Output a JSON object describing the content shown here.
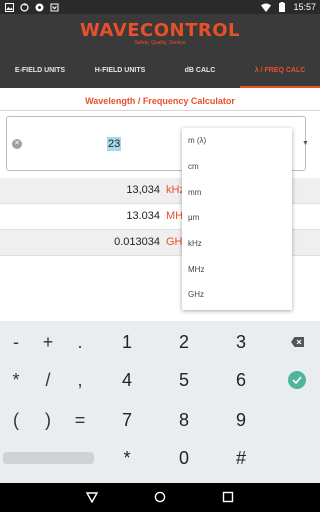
{
  "status_bar": {
    "time": "15:57",
    "icons_left": [
      "image-icon",
      "sync-icon",
      "location-icon",
      "storage-icon"
    ],
    "icons_right": [
      "wifi-icon",
      "battery-icon"
    ]
  },
  "app": {
    "logo_text": "WAVECONTROL",
    "tagline": "Safety, Quality, Service",
    "brand_color": "#e8502a"
  },
  "tabs": [
    {
      "label": "E-FIELD UNITS",
      "active": false
    },
    {
      "label": "H-FIELD UNITS",
      "active": false
    },
    {
      "label": "dB CALC",
      "active": false
    },
    {
      "label": "λ / FREQ CALC",
      "active": true
    }
  ],
  "calculator": {
    "title": "Wavelength / Frequency Calculator",
    "input_value": "23",
    "results": [
      {
        "value": "13,034",
        "unit": "kHz"
      },
      {
        "value": "13.034",
        "unit": "MH"
      },
      {
        "value": "0.013034",
        "unit": "GH"
      }
    ]
  },
  "unit_dropdown": {
    "options": [
      "m (λ)",
      "cm",
      "mm",
      "μm",
      "kHz",
      "MHz",
      "GHz"
    ]
  },
  "keyboard": {
    "rows": [
      [
        "-",
        "+",
        ".",
        "1",
        "2",
        "3",
        "backspace"
      ],
      [
        "*",
        "/",
        ",",
        "4",
        "5",
        "6",
        "done"
      ],
      [
        "(",
        ")",
        "=",
        "7",
        "8",
        "9",
        ""
      ],
      [
        "space",
        "",
        "",
        "*",
        "0",
        "#",
        ""
      ]
    ],
    "accent_color": "#4fb49a"
  }
}
